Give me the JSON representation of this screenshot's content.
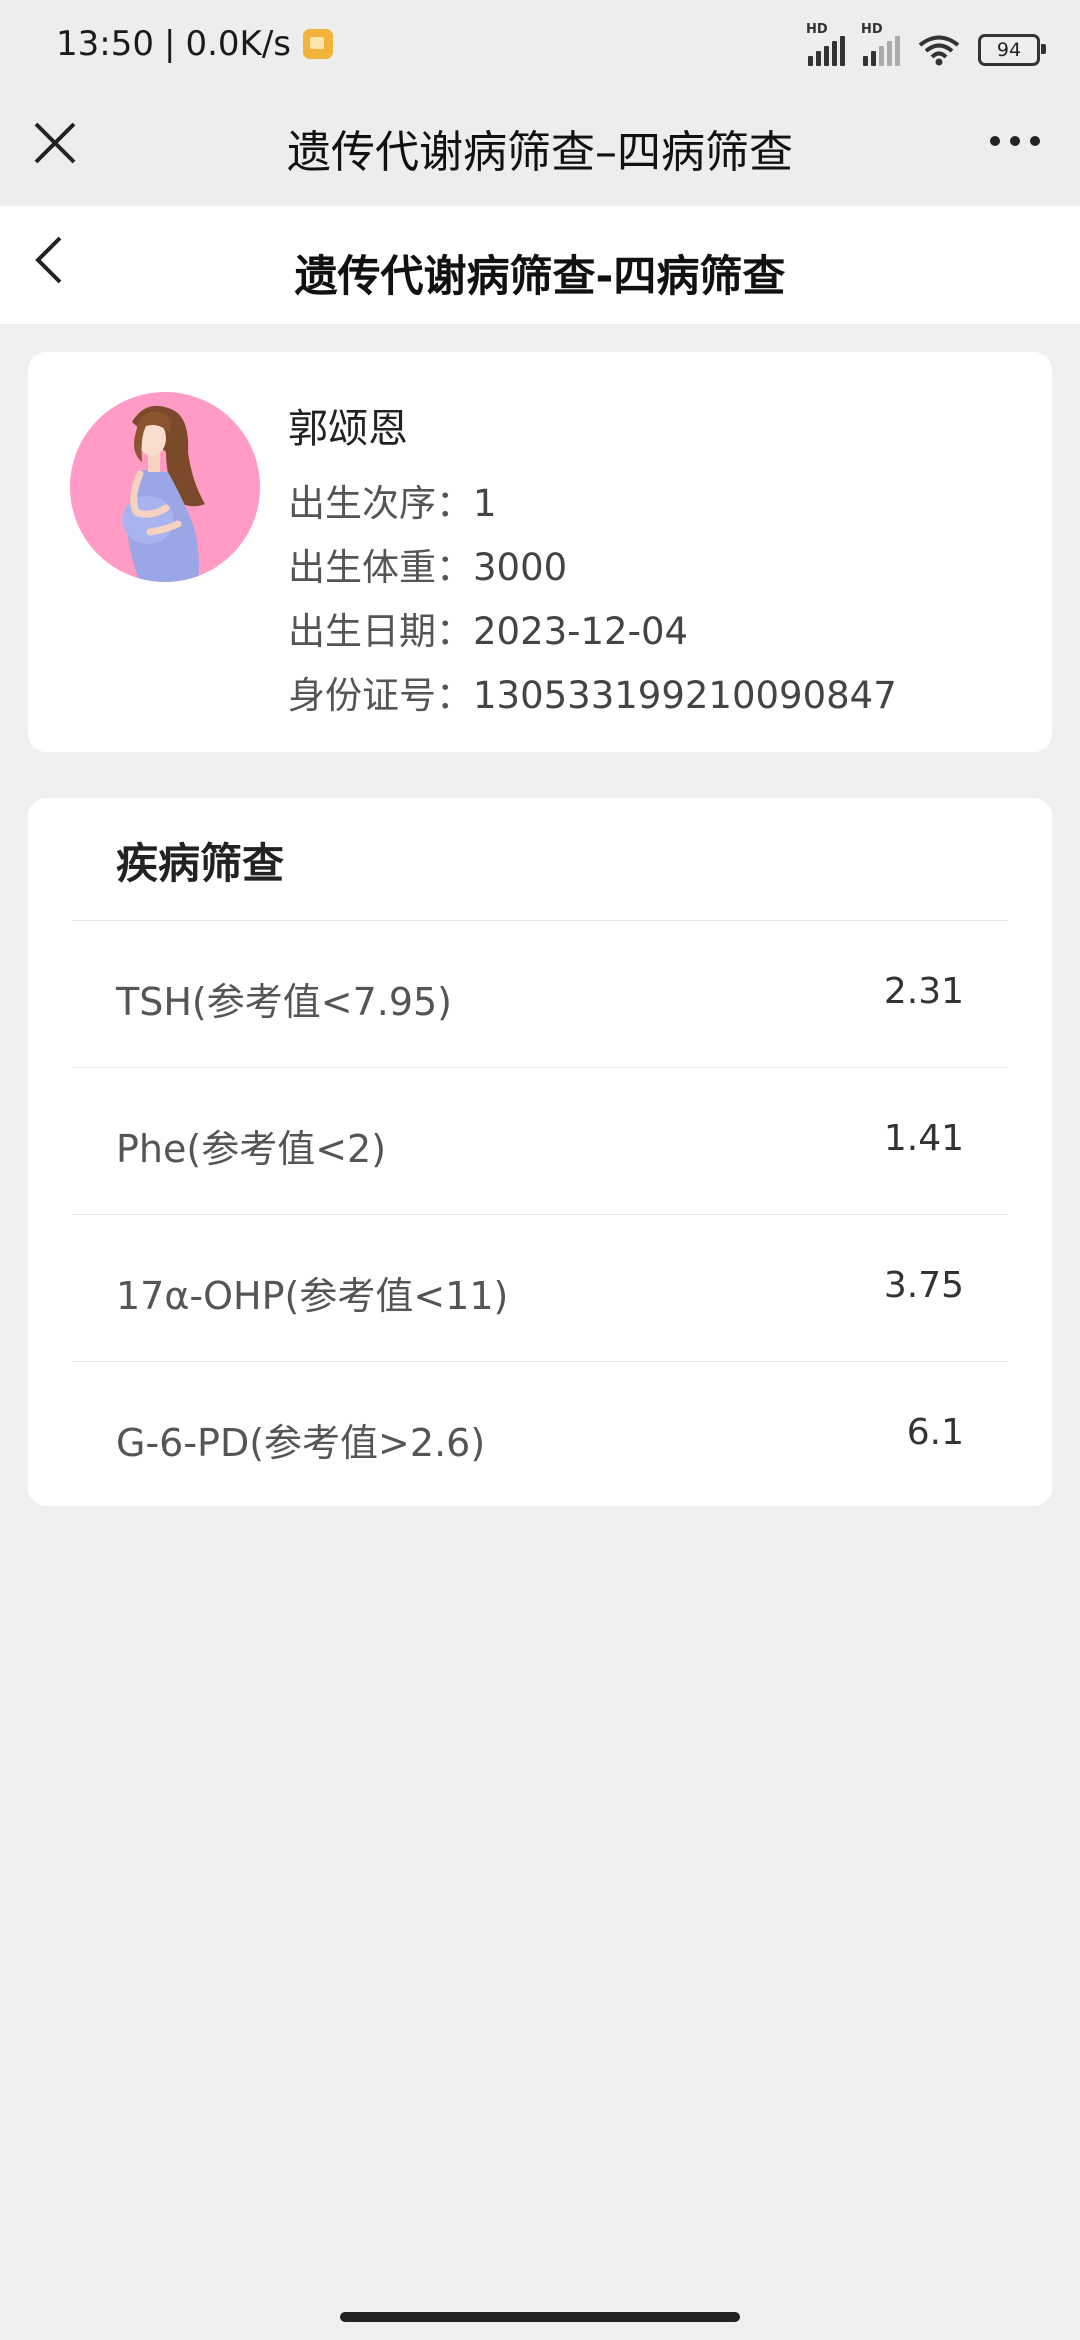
{
  "status_bar": {
    "time": "13:50",
    "separator": "|",
    "network_speed": "0.0K/s",
    "battery_level": "94",
    "icons": [
      "notification-icon",
      "hd-signal-icon",
      "hd-signal-weak-icon",
      "wifi-icon",
      "battery-icon"
    ]
  },
  "app_bar": {
    "title": "遗传代谢病筛查–四病筛查",
    "close_icon": "close-icon",
    "more_icon": "more-icon"
  },
  "page_header": {
    "title": "遗传代谢病筛查-四病筛查",
    "back_icon": "chevron-left-icon"
  },
  "profile": {
    "name": "郭颂恩",
    "avatar_icon": "pregnant-woman-avatar",
    "fields": [
      {
        "label": "出生次序：",
        "value": "1"
      },
      {
        "label": "出生体重：",
        "value": "3000"
      },
      {
        "label": "出生日期：",
        "value": "2023-12-04"
      },
      {
        "label": "身份证号：",
        "value": "130533199210090847"
      }
    ]
  },
  "screening": {
    "title": "疾病筛查",
    "items": [
      {
        "label": "TSH(参考值<7.95)",
        "value": "2.31"
      },
      {
        "label": "Phe(参考值<2)",
        "value": "1.41"
      },
      {
        "label": "17α-OHP(参考值<11)",
        "value": "3.75"
      },
      {
        "label": "G-6-PD(参考值>2.6)",
        "value": "6.1"
      }
    ]
  },
  "colors": {
    "background": "#efefef",
    "card": "#ffffff",
    "avatar_bg": "#ff9bc4"
  }
}
